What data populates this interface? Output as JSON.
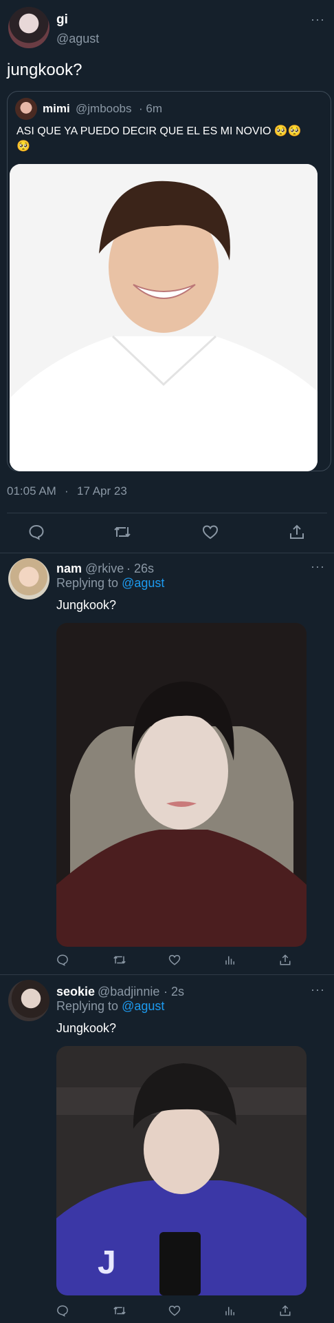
{
  "main_tweet": {
    "name": "gi",
    "handle": "@agust",
    "text": "jungkook?",
    "more": "···",
    "timestamp": "01:05 AM",
    "sep": "·",
    "date": "17 Apr 23"
  },
  "quoted_tweet": {
    "name": "mimi",
    "handle": "@jmboobs",
    "time": "· 6m",
    "text": "ASI QUE YA PUEDO DECIR QUE EL ES MI NOVIO 🥺🥺🥺"
  },
  "replies": [
    {
      "name": "nam",
      "handle": "@rkive",
      "time": "· 26s",
      "replying_prefix": "Replying to ",
      "replying_to": "@agust",
      "text": "Jungkook?",
      "more": "···"
    },
    {
      "name": "seokie",
      "handle": "@badjinnie",
      "time": "· 2s",
      "replying_prefix": "Replying to ",
      "replying_to": "@agust",
      "text": "Jungkook?",
      "more": "···"
    }
  ],
  "icons": {
    "reply": "reply-icon",
    "retweet": "retweet-icon",
    "like": "like-icon",
    "share": "share-icon",
    "views": "views-icon"
  },
  "colors": {
    "background": "#15202b",
    "accent": "#1d9bf0",
    "muted": "#8b98a5"
  }
}
